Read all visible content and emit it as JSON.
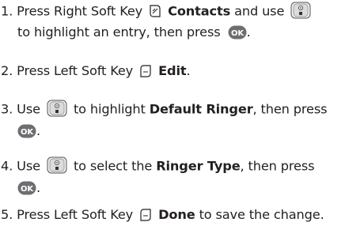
{
  "steps": [
    {
      "number": "1.",
      "line1_a": "Press Right Soft Key",
      "line1_bold": "Contacts",
      "line1_b": "and use",
      "line2_a": "to highlight an entry, then press",
      "line2_end": "."
    },
    {
      "number": "2.",
      "text_a": "Press Left Soft Key",
      "bold": "Edit",
      "text_end": "."
    },
    {
      "number": "3.",
      "text_a": "Use",
      "text_b": "to highlight",
      "bold": "Default Ringer",
      "text_c": ", then press",
      "line2_end": "."
    },
    {
      "number": "4.",
      "text_a": "Use",
      "text_b": "to select the",
      "bold": "Ringer Type",
      "text_c": ", then press",
      "line2_end": "."
    },
    {
      "number": "5.",
      "text_a": "Press Left Soft Key",
      "bold": "Done",
      "text_b": "to save the change."
    }
  ],
  "icons": {
    "right_soft_key": "right-soft-key-icon",
    "left_soft_key": "left-soft-key-icon",
    "navigation_key": "navigation-key-icon",
    "ok_key": "ok-key-icon",
    "ok_label": "OK"
  }
}
